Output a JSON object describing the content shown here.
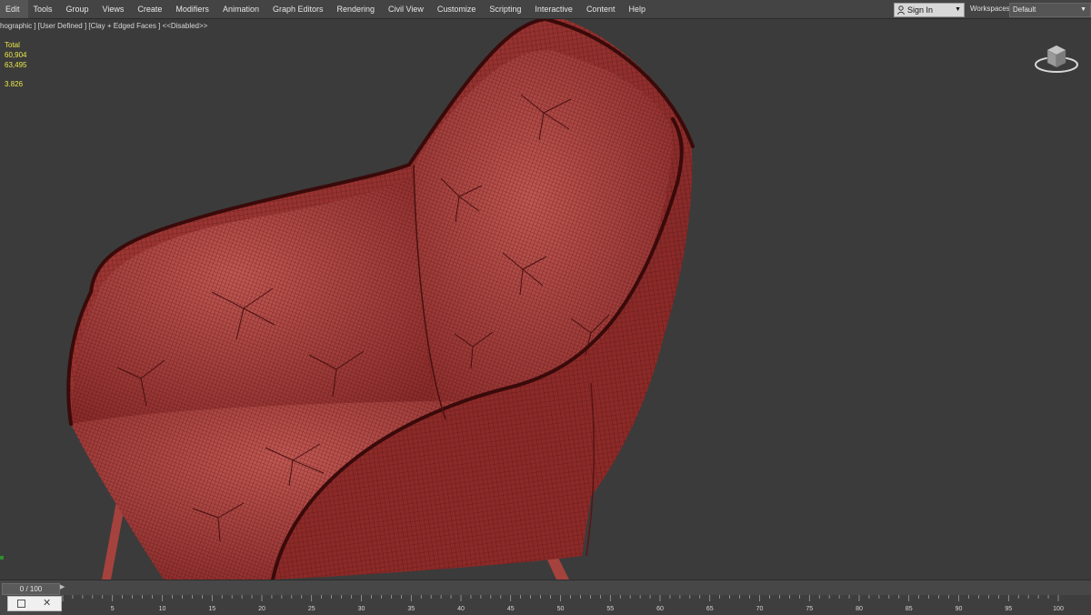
{
  "menu": {
    "items": [
      {
        "label": "Edit",
        "name": "menu-edit"
      },
      {
        "label": "Tools",
        "name": "menu-tools"
      },
      {
        "label": "Group",
        "name": "menu-group"
      },
      {
        "label": "Views",
        "name": "menu-views"
      },
      {
        "label": "Create",
        "name": "menu-create"
      },
      {
        "label": "Modifiers",
        "name": "menu-modifiers"
      },
      {
        "label": "Animation",
        "name": "menu-animation"
      },
      {
        "label": "Graph Editors",
        "name": "menu-graph-editors"
      },
      {
        "label": "Rendering",
        "name": "menu-rendering"
      },
      {
        "label": "Civil View",
        "name": "menu-civil-view"
      },
      {
        "label": "Customize",
        "name": "menu-customize"
      },
      {
        "label": "Scripting",
        "name": "menu-scripting"
      },
      {
        "label": "Interactive",
        "name": "menu-interactive"
      },
      {
        "label": "Content",
        "name": "menu-content"
      },
      {
        "label": "Help",
        "name": "menu-help"
      }
    ],
    "signin_label": "Sign In",
    "workspaces_label": "Workspaces:",
    "workspace_value": "Default"
  },
  "viewport": {
    "label": "hographic ] [User Defined ] [Clay + Edged Faces ]  <<Disabled>>",
    "stats": {
      "header": "Total",
      "polys": "60,904",
      "verts": "63,495",
      "fps": "3.826"
    },
    "colors": {
      "background": "#3b3b3b",
      "mesh": "#8e2b2b",
      "mesh_light": "#b44a45",
      "wire": "#3a0c0c",
      "stats_text": "#e8e84a"
    },
    "object": "tufted armchair",
    "viewcube_icon": "viewcube-icon"
  },
  "timeline": {
    "frame_display": "0 / 100",
    "frame_current": 0,
    "frame_total": 100,
    "tick_labels": [
      "5",
      "10",
      "15",
      "20",
      "25",
      "30",
      "35",
      "40",
      "45",
      "50",
      "55",
      "60",
      "65",
      "70",
      "75",
      "80",
      "85",
      "90",
      "95",
      "100"
    ]
  }
}
